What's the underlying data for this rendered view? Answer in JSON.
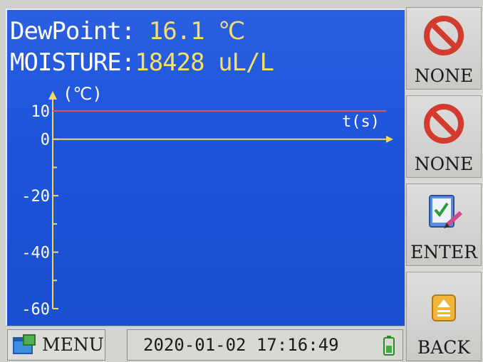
{
  "readouts": {
    "dewpoint_label": "DewPoint:",
    "dewpoint_value": "16.1",
    "dewpoint_unit": "℃",
    "moisture_label": "MOISTURE:",
    "moisture_value": "18428",
    "moisture_unit": "uL/L"
  },
  "chart": {
    "y_axis_label": "(℃)",
    "x_axis_label": "t(s)",
    "y_ticks": [
      "10",
      "0",
      "-20",
      "-40",
      "-60"
    ]
  },
  "chart_data": {
    "type": "line",
    "ylim": [
      -60,
      10
    ],
    "y_tick_values": [
      10,
      0,
      -20,
      -40,
      -60
    ],
    "series": [
      {
        "values": [
          10,
          10
        ]
      }
    ]
  },
  "softkeys": [
    {
      "label": "NONE",
      "icon": "no-entry-icon"
    },
    {
      "label": "NONE",
      "icon": "no-entry-icon"
    },
    {
      "label": "ENTER",
      "icon": "checklist-pen-icon"
    },
    {
      "label": "BACK",
      "icon": "eject-up-icon"
    }
  ],
  "statusbar": {
    "menu_label": "MENU",
    "datetime": "2020-01-02 17:16:49",
    "battery_icon": "battery-icon"
  },
  "colors": {
    "screen_bg": "#2056dc",
    "axis": "#f3da5a",
    "trace": "#e0524a",
    "value_text": "#f6de6a"
  }
}
